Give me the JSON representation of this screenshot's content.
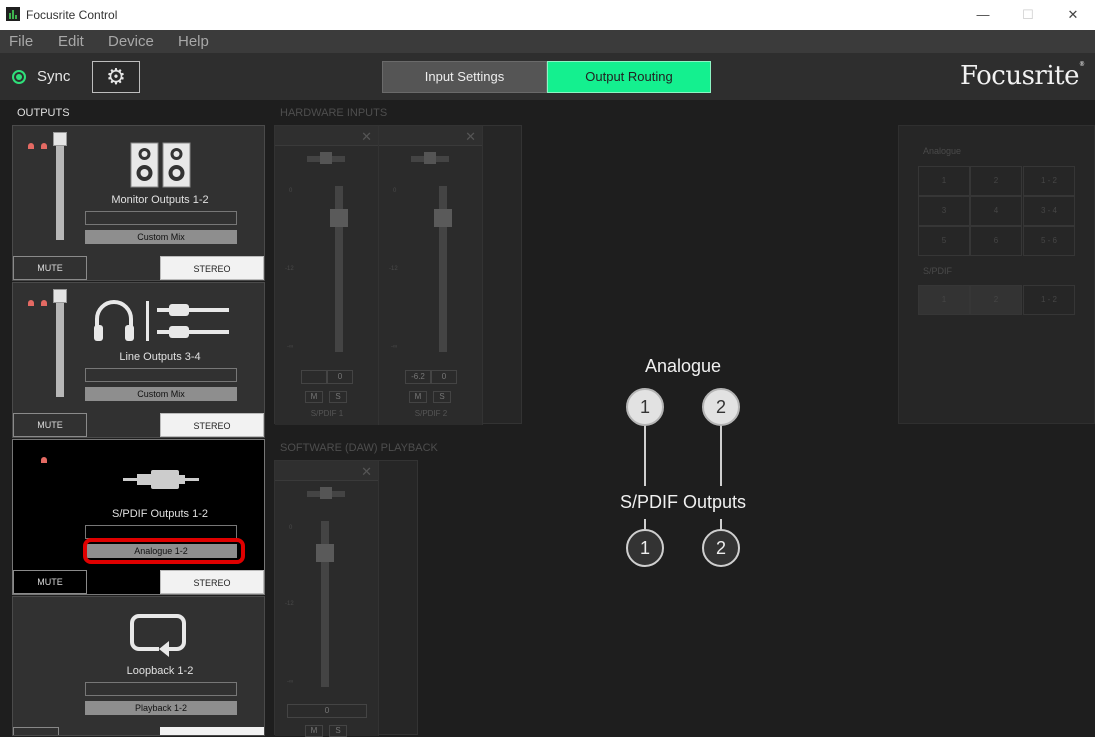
{
  "window": {
    "title": "Focusrite Control",
    "minimize": "—",
    "maximize": "☐",
    "close": "✕"
  },
  "menu": [
    "File",
    "Edit",
    "Device",
    "Help"
  ],
  "toolbar": {
    "sync_label": "Sync",
    "settings_icon": "⚙",
    "tabs": [
      {
        "label": "Input Settings",
        "active": false
      },
      {
        "label": "Output Routing",
        "active": true
      }
    ],
    "brand": "Focusrite",
    "brand_mark": "®",
    "accent_color": "#14f08f"
  },
  "outputs": {
    "header": "OUTPUTS",
    "cards": [
      {
        "name": "Monitor Outputs 1-2",
        "source": "Custom Mix",
        "mute": "MUTE",
        "mode": "STEREO",
        "icon": "speakers-icon"
      },
      {
        "name": "Line Outputs 3-4",
        "source": "Custom Mix",
        "mute": "MUTE",
        "mode": "STEREO",
        "icon": "headphones-cable-icon"
      },
      {
        "name": "S/PDIF Outputs 1-2",
        "source": "Analogue 1-2",
        "mute": "MUTE",
        "mode": "STEREO",
        "icon": "spdif-cable-icon",
        "selected": true
      },
      {
        "name": "Loopback 1-2",
        "source": "Playback 1-2",
        "icon": "loopback-icon"
      }
    ]
  },
  "hardware_inputs": {
    "header": "HARDWARE INPUTS",
    "close_glyph": "✕",
    "strips": [
      {
        "name": "S/PDIF 1",
        "gain": "0",
        "level": "",
        "mute": "M",
        "solo": "S",
        "marks": [
          "0",
          "-12",
          "-∞"
        ]
      },
      {
        "name": "S/PDIF 2",
        "gain": "0",
        "level": "-6.2",
        "mute": "M",
        "solo": "S",
        "marks": [
          "0",
          "-12",
          "-∞"
        ]
      }
    ]
  },
  "software_playback": {
    "header": "SOFTWARE (DAW) PLAYBACK",
    "close_glyph": "✕",
    "strips": [
      {
        "gain": "0",
        "mute": "M",
        "solo": "S",
        "marks": [
          "0",
          "-12",
          "-∞"
        ]
      }
    ]
  },
  "routing": {
    "source_title": "Analogue",
    "dest_title": "S/PDIF Outputs",
    "sources": [
      "1",
      "2"
    ],
    "destinations": [
      "1",
      "2"
    ]
  },
  "matrix": {
    "analogue_label": "Analogue",
    "spdif_label": "S/PDIF",
    "analogue_cells": [
      "1",
      "2",
      "1 - 2",
      "3",
      "4",
      "3 - 4",
      "5",
      "6",
      "5 - 6"
    ],
    "spdif_cells": [
      "1",
      "2",
      "1 - 2"
    ]
  }
}
